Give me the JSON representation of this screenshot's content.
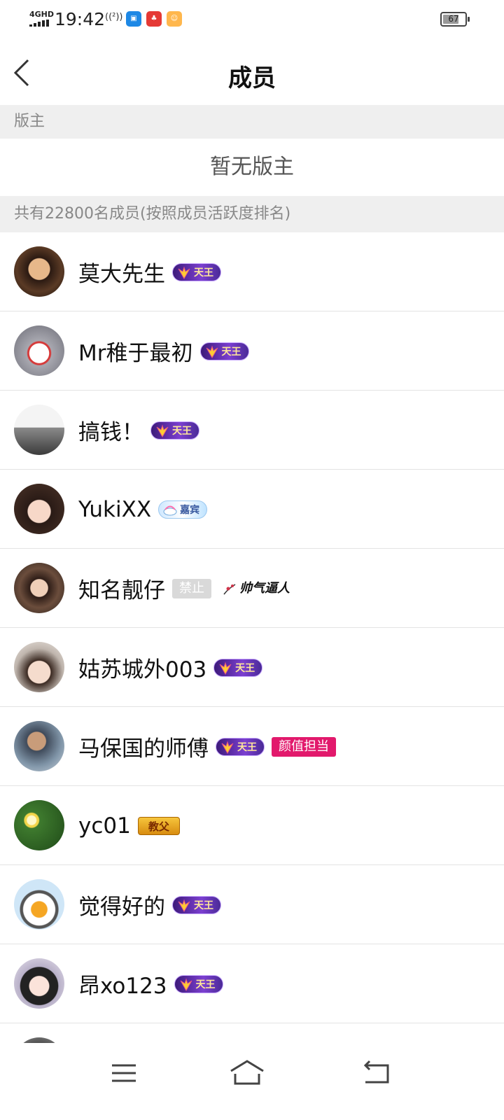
{
  "status_bar": {
    "network": "4GHD",
    "time": "19:42",
    "hotspot": "((²))",
    "battery": "67",
    "app_icons": [
      "app-icon-blue",
      "app-icon-red",
      "app-icon-cat"
    ]
  },
  "header": {
    "title": "成员"
  },
  "moderator_section": {
    "heading": "版主",
    "empty_text": "暂无版主"
  },
  "members_section": {
    "heading": "共有22800名成员(按照成员活跃度排名)"
  },
  "members": [
    {
      "name": "莫大先生",
      "badges": [
        {
          "type": "tianwang",
          "text": "天王"
        }
      ]
    },
    {
      "name": "Mr稚于最初",
      "badges": [
        {
          "type": "tianwang",
          "text": "天王"
        }
      ]
    },
    {
      "name": "搞钱！",
      "badges": [
        {
          "type": "tianwang",
          "text": "天王"
        }
      ]
    },
    {
      "name": "YukiXX",
      "badges": [
        {
          "type": "cloud",
          "text": "嘉宾"
        }
      ]
    },
    {
      "name": "知名靓仔",
      "badges": [
        {
          "type": "ban",
          "text": "禁止"
        },
        {
          "type": "calli",
          "text": "帅气逼人"
        }
      ]
    },
    {
      "name": "姑苏城外003",
      "badges": [
        {
          "type": "tianwang",
          "text": "天王"
        }
      ]
    },
    {
      "name": "马保国的师傅",
      "badges": [
        {
          "type": "tianwang",
          "text": "天王"
        },
        {
          "type": "pink",
          "text": "颜值担当"
        }
      ]
    },
    {
      "name": "yc01",
      "badges": [
        {
          "type": "gold",
          "text": "教父"
        }
      ]
    },
    {
      "name": "觉得好的",
      "badges": [
        {
          "type": "tianwang",
          "text": "天王"
        }
      ]
    },
    {
      "name": "昂xo123",
      "badges": [
        {
          "type": "tianwang",
          "text": "天王"
        }
      ]
    },
    {
      "name": "",
      "badges": []
    }
  ],
  "nav": {
    "icons": [
      "menu-icon",
      "home-icon",
      "back-icon"
    ]
  },
  "colors": {
    "section_bg": "#efefef",
    "divider": "#e3e3e3",
    "badge_purple": "#5a2aa8",
    "badge_pink": "#e2196c"
  }
}
